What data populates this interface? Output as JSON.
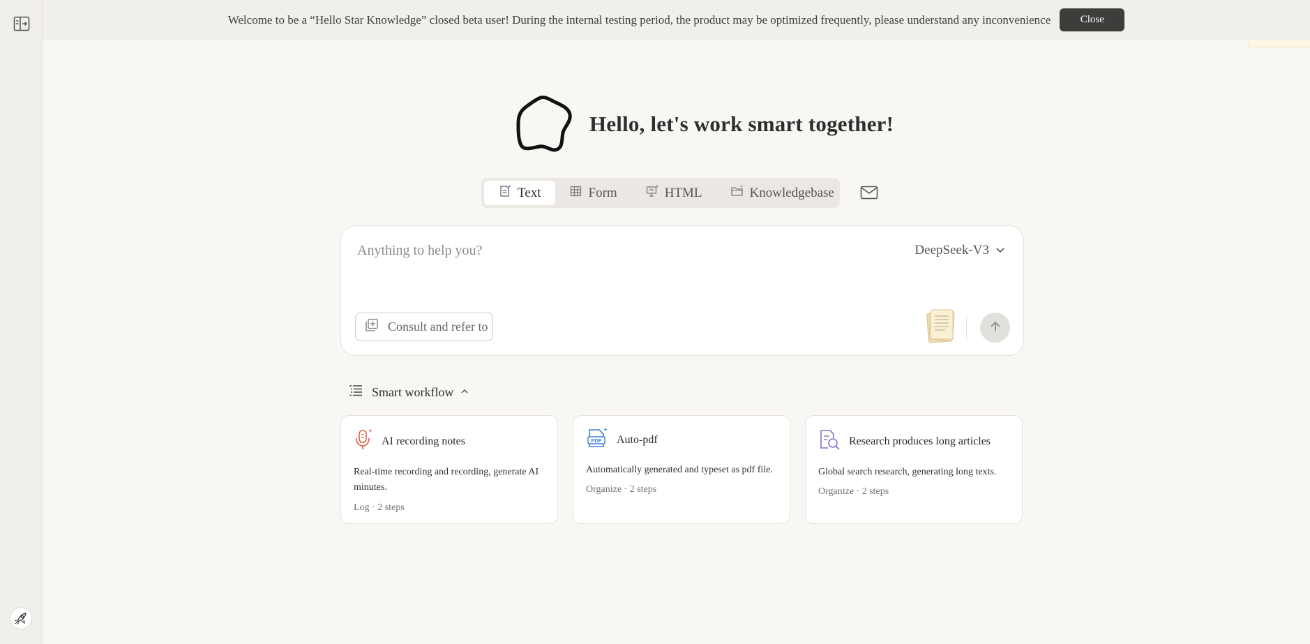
{
  "banner": {
    "message": "Welcome to be a “Hello Star Knowledge” closed beta user! During the internal testing period, the product may be optimized frequently, please understand any inconvenience",
    "close_label": "Close"
  },
  "sidebar": {
    "toggle_icon": "sidebar-toggle-icon",
    "avatar_icon": "rocket-avatar-icon"
  },
  "hero": {
    "title": "Hello, let's work smart together!",
    "logo_icon": "star-outline-logo"
  },
  "modes": {
    "items": [
      {
        "label": "Text",
        "icon": "text-doc-icon",
        "active": true
      },
      {
        "label": "Form",
        "icon": "table-icon",
        "active": false
      },
      {
        "label": "HTML",
        "icon": "presentation-icon",
        "active": false
      },
      {
        "label": "Knowledgebase",
        "icon": "folder-icon",
        "active": false
      }
    ],
    "mail_icon": "mail-icon"
  },
  "composer": {
    "placeholder": "Anything to help you?",
    "model": "DeepSeek-V3",
    "consult_label": "Consult and refer to"
  },
  "workflow": {
    "title": "Smart workflow",
    "cards": [
      {
        "title": "AI recording notes",
        "icon": "microphone-icon",
        "description": "Real-time recording and recording, generate AI minutes.",
        "meta": "Log · 2 steps"
      },
      {
        "title": "Auto-pdf",
        "icon": "pdf-icon",
        "description": "Automatically generated and typeset as pdf file.",
        "meta": "Organize · 2 steps"
      },
      {
        "title": "Research produces long articles",
        "icon": "doc-search-icon",
        "description": "Global search research, generating long texts.",
        "meta": "Organize · 2 steps"
      }
    ]
  },
  "colors": {
    "background": "#f9f7f4",
    "rail": "#f1efeb",
    "close_button": "#3d3d3b",
    "mic_accent": "#d9603f",
    "pdf_accent": "#3b7fd4",
    "research_accent": "#8a6fd0"
  }
}
